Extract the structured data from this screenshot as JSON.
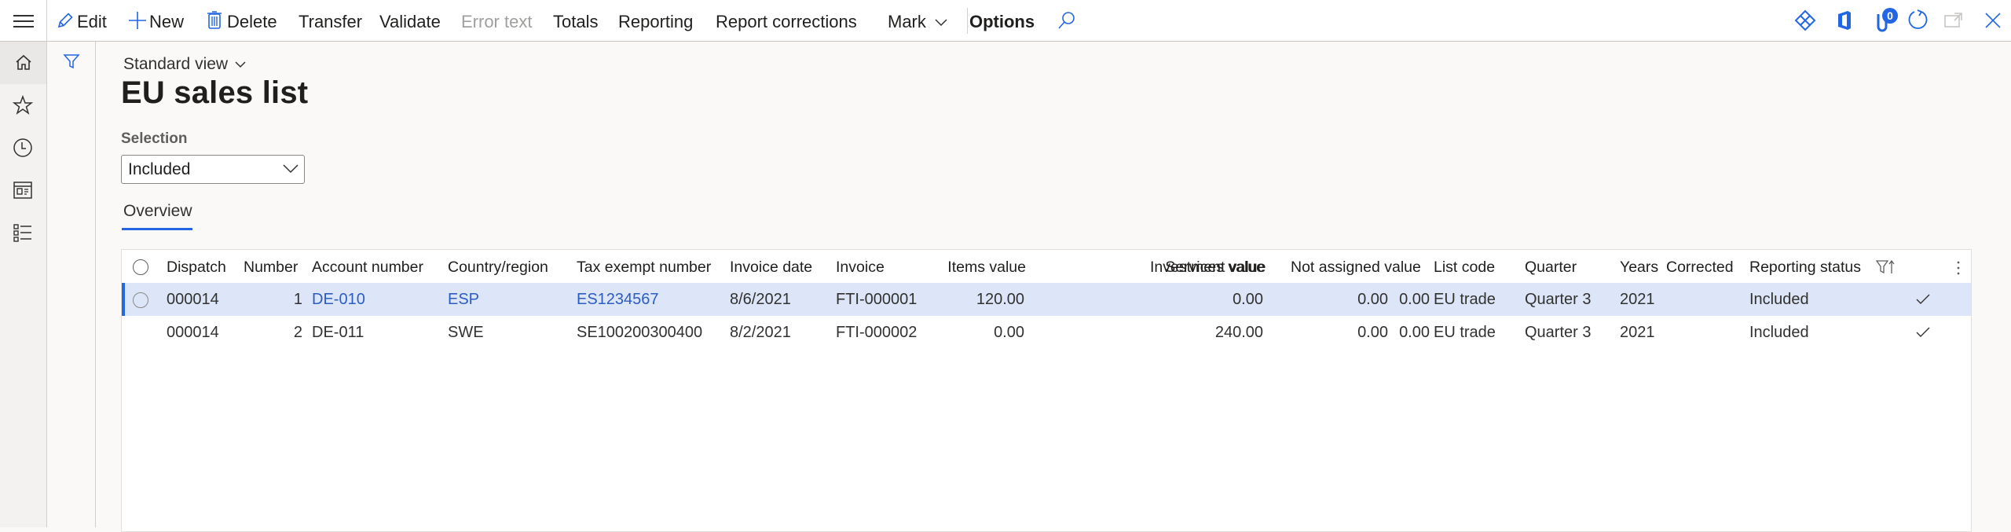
{
  "toolbar": {
    "items": [
      {
        "label": "Edit",
        "icon": "pencil-icon",
        "enabled": true
      },
      {
        "label": "New",
        "icon": "plus-icon",
        "enabled": true
      },
      {
        "label": "Delete",
        "icon": "trash-icon",
        "enabled": true
      },
      {
        "label": "Transfer",
        "enabled": true
      },
      {
        "label": "Validate",
        "enabled": true
      },
      {
        "label": "Error text",
        "enabled": false
      },
      {
        "label": "Totals",
        "enabled": true
      },
      {
        "label": "Reporting",
        "enabled": true
      },
      {
        "label": "Report corrections",
        "enabled": true
      },
      {
        "label": "Mark",
        "icon": "chevron-down-icon",
        "enabled": true
      },
      {
        "label": "Options",
        "enabled": true
      }
    ],
    "right_icons": [
      "power-apps-icon",
      "office-icon",
      "attachments-icon",
      "refresh-icon",
      "open-new-window-icon",
      "close-icon"
    ],
    "attachments_badge": "0"
  },
  "leftnav": [
    "home-icon",
    "star-icon",
    "clock-icon",
    "workspace-icon",
    "list-icon"
  ],
  "page": {
    "view_name": "Standard view",
    "title": "EU sales list",
    "selection_label": "Selection",
    "selection_value": "Included",
    "tabs": [
      {
        "label": "Overview",
        "active": true
      }
    ]
  },
  "grid": {
    "columns": [
      "Dispatch",
      "Number",
      "Account number",
      "Country/region",
      "Tax exempt number",
      "Invoice date",
      "Invoice",
      "Items value",
      "Services value",
      "Investment value",
      "Not assigned value",
      "List code",
      "Quarter",
      "Years",
      "Corrected",
      "Reporting status"
    ],
    "rows": [
      {
        "dispatch": "000014",
        "number": "1",
        "account": "DE-010",
        "country": "ESP",
        "tax_exempt": "ES1234567",
        "invoice_date": "8/6/2021",
        "invoice": "FTI-000001",
        "items_value": "120.00",
        "services_value": "0.00",
        "investment_value": "0.00",
        "not_assigned_value": "0.00",
        "list_code": "EU trade",
        "quarter": "Quarter 3",
        "years": "2021",
        "corrected": "",
        "reporting_status": "Included",
        "included_check": true,
        "selected": true
      },
      {
        "dispatch": "000014",
        "number": "2",
        "account": "DE-011",
        "country": "SWE",
        "tax_exempt": "SE100200300400",
        "invoice_date": "8/2/2021",
        "invoice": "FTI-000002",
        "items_value": "0.00",
        "services_value": "240.00",
        "investment_value": "0.00",
        "not_assigned_value": "0.00",
        "list_code": "EU trade",
        "quarter": "Quarter 3",
        "years": "2021",
        "corrected": "",
        "reporting_status": "Included",
        "included_check": true,
        "selected": false
      }
    ]
  },
  "colors": {
    "accent": "#2266e3",
    "link": "#2c5cc5",
    "selected_row": "#dce6f8"
  }
}
